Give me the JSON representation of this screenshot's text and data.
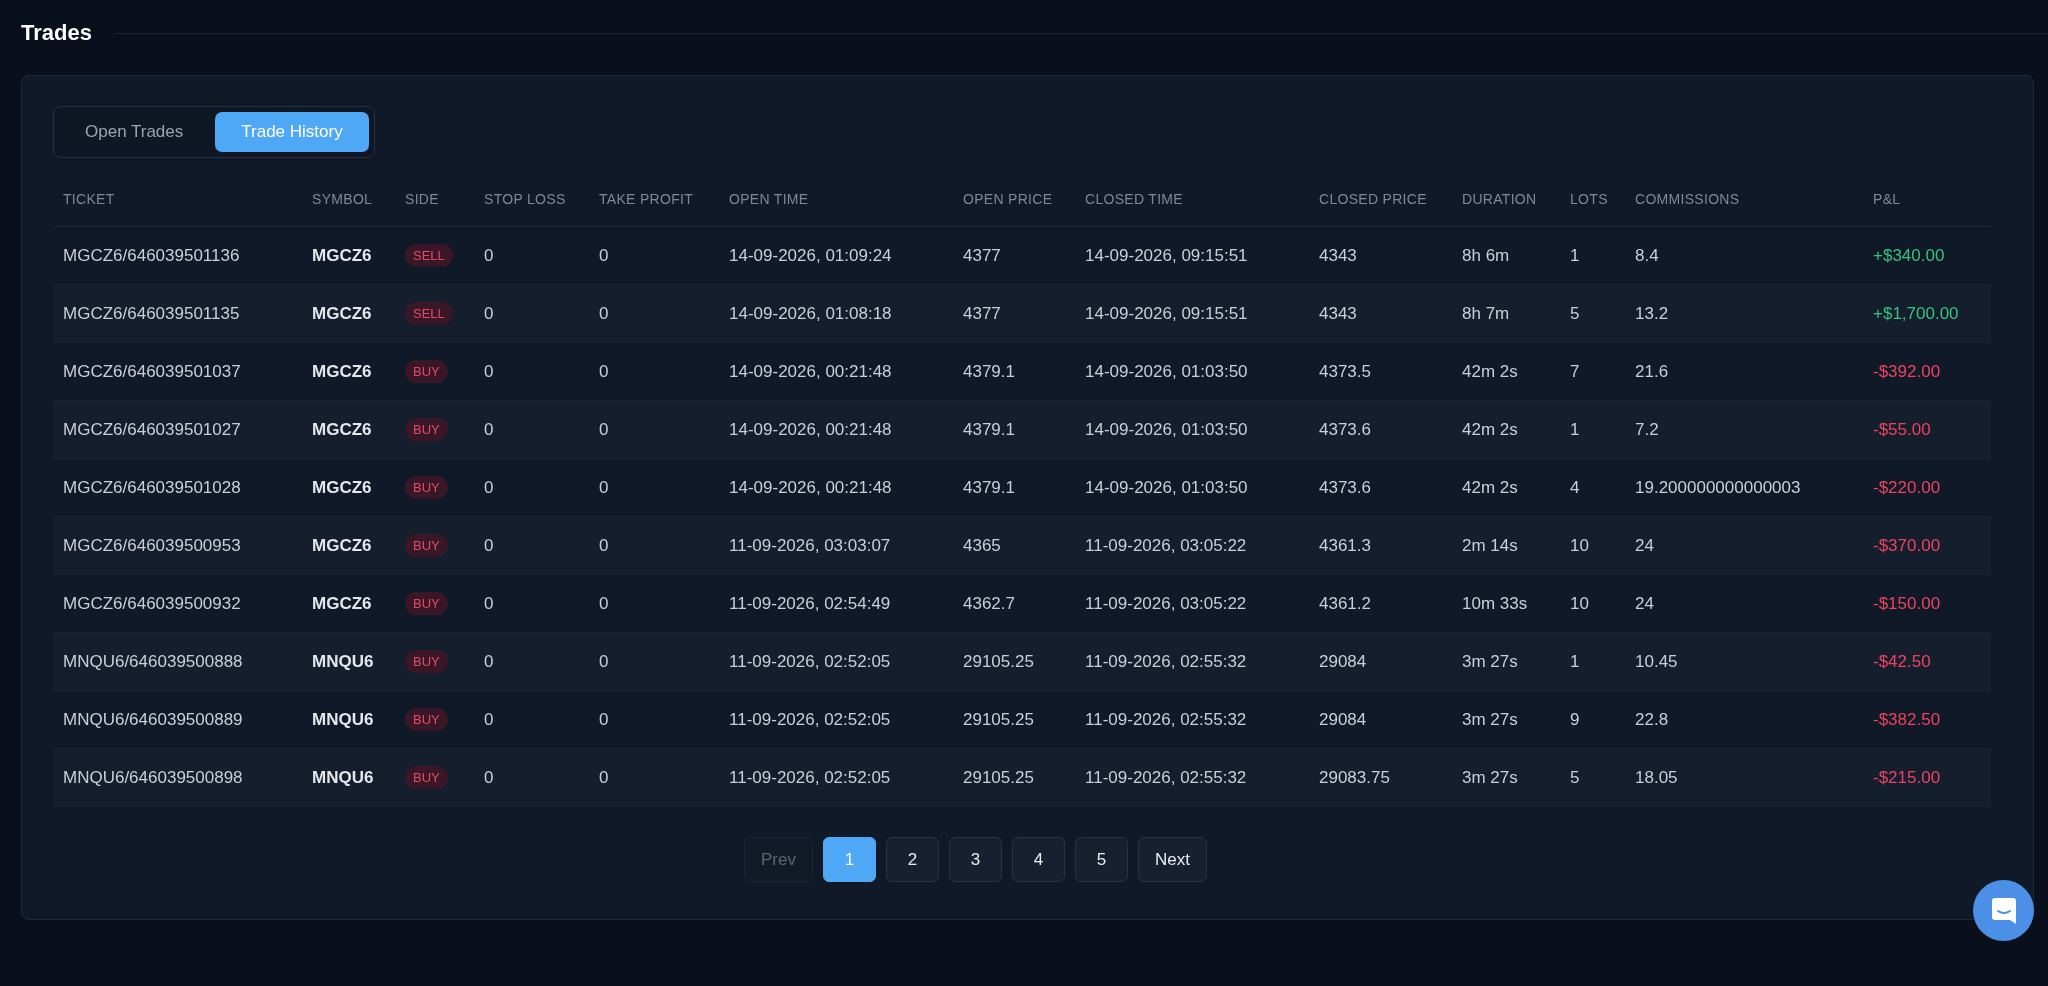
{
  "page": {
    "title": "Trades"
  },
  "tabs": [
    {
      "label": "Open Trades",
      "selected": false
    },
    {
      "label": "Trade History",
      "selected": true
    }
  ],
  "table": {
    "columns": [
      "TICKET",
      "SYMBOL",
      "SIDE",
      "STOP LOSS",
      "TAKE PROFIT",
      "OPEN TIME",
      "OPEN PRICE",
      "CLOSED TIME",
      "CLOSED PRICE",
      "DURATION",
      "LOTS",
      "COMMISSIONS",
      "P&L"
    ],
    "rows": [
      {
        "ticket": "MGCZ6/646039501136",
        "symbol": "MGCZ6",
        "side": "SELL",
        "stop_loss": "0",
        "take_profit": "0",
        "open_time": "14-09-2026, 01:09:24",
        "open_price": "4377",
        "closed_time": "14-09-2026, 09:15:51",
        "closed_price": "4343",
        "duration": "8h 6m",
        "lots": "1",
        "commissions": "8.4",
        "pnl": "+$340.00",
        "profit": true
      },
      {
        "ticket": "MGCZ6/646039501135",
        "symbol": "MGCZ6",
        "side": "SELL",
        "stop_loss": "0",
        "take_profit": "0",
        "open_time": "14-09-2026, 01:08:18",
        "open_price": "4377",
        "closed_time": "14-09-2026, 09:15:51",
        "closed_price": "4343",
        "duration": "8h 7m",
        "lots": "5",
        "commissions": "13.2",
        "pnl": "+$1,700.00",
        "profit": true
      },
      {
        "ticket": "MGCZ6/646039501037",
        "symbol": "MGCZ6",
        "side": "BUY",
        "stop_loss": "0",
        "take_profit": "0",
        "open_time": "14-09-2026, 00:21:48",
        "open_price": "4379.1",
        "closed_time": "14-09-2026, 01:03:50",
        "closed_price": "4373.5",
        "duration": "42m 2s",
        "lots": "7",
        "commissions": "21.6",
        "pnl": "-$392.00",
        "profit": false
      },
      {
        "ticket": "MGCZ6/646039501027",
        "symbol": "MGCZ6",
        "side": "BUY",
        "stop_loss": "0",
        "take_profit": "0",
        "open_time": "14-09-2026, 00:21:48",
        "open_price": "4379.1",
        "closed_time": "14-09-2026, 01:03:50",
        "closed_price": "4373.6",
        "duration": "42m 2s",
        "lots": "1",
        "commissions": "7.2",
        "pnl": "-$55.00",
        "profit": false
      },
      {
        "ticket": "MGCZ6/646039501028",
        "symbol": "MGCZ6",
        "side": "BUY",
        "stop_loss": "0",
        "take_profit": "0",
        "open_time": "14-09-2026, 00:21:48",
        "open_price": "4379.1",
        "closed_time": "14-09-2026, 01:03:50",
        "closed_price": "4373.6",
        "duration": "42m 2s",
        "lots": "4",
        "commissions": "19.200000000000003",
        "pnl": "-$220.00",
        "profit": false
      },
      {
        "ticket": "MGCZ6/646039500953",
        "symbol": "MGCZ6",
        "side": "BUY",
        "stop_loss": "0",
        "take_profit": "0",
        "open_time": "11-09-2026, 03:03:07",
        "open_price": "4365",
        "closed_time": "11-09-2026, 03:05:22",
        "closed_price": "4361.3",
        "duration": "2m 14s",
        "lots": "10",
        "commissions": "24",
        "pnl": "-$370.00",
        "profit": false
      },
      {
        "ticket": "MGCZ6/646039500932",
        "symbol": "MGCZ6",
        "side": "BUY",
        "stop_loss": "0",
        "take_profit": "0",
        "open_time": "11-09-2026, 02:54:49",
        "open_price": "4362.7",
        "closed_time": "11-09-2026, 03:05:22",
        "closed_price": "4361.2",
        "duration": "10m 33s",
        "lots": "10",
        "commissions": "24",
        "pnl": "-$150.00",
        "profit": false
      },
      {
        "ticket": "MNQU6/646039500888",
        "symbol": "MNQU6",
        "side": "BUY",
        "stop_loss": "0",
        "take_profit": "0",
        "open_time": "11-09-2026, 02:52:05",
        "open_price": "29105.25",
        "closed_time": "11-09-2026, 02:55:32",
        "closed_price": "29084",
        "duration": "3m 27s",
        "lots": "1",
        "commissions": "10.45",
        "pnl": "-$42.50",
        "profit": false
      },
      {
        "ticket": "MNQU6/646039500889",
        "symbol": "MNQU6",
        "side": "BUY",
        "stop_loss": "0",
        "take_profit": "0",
        "open_time": "11-09-2026, 02:52:05",
        "open_price": "29105.25",
        "closed_time": "11-09-2026, 02:55:32",
        "closed_price": "29084",
        "duration": "3m 27s",
        "lots": "9",
        "commissions": "22.8",
        "pnl": "-$382.50",
        "profit": false
      },
      {
        "ticket": "MNQU6/646039500898",
        "symbol": "MNQU6",
        "side": "BUY",
        "stop_loss": "0",
        "take_profit": "0",
        "open_time": "11-09-2026, 02:52:05",
        "open_price": "29105.25",
        "closed_time": "11-09-2026, 02:55:32",
        "closed_price": "29083.75",
        "duration": "3m 27s",
        "lots": "5",
        "commissions": "18.05",
        "pnl": "-$215.00",
        "profit": false
      }
    ]
  },
  "pagination": {
    "prev": {
      "label": "Prev",
      "disabled": true
    },
    "pages": [
      {
        "label": "1",
        "selected": true
      },
      {
        "label": "2",
        "selected": false
      },
      {
        "label": "3",
        "selected": false
      },
      {
        "label": "4",
        "selected": false
      },
      {
        "label": "5",
        "selected": false
      }
    ],
    "next": {
      "label": "Next",
      "disabled": false
    }
  }
}
